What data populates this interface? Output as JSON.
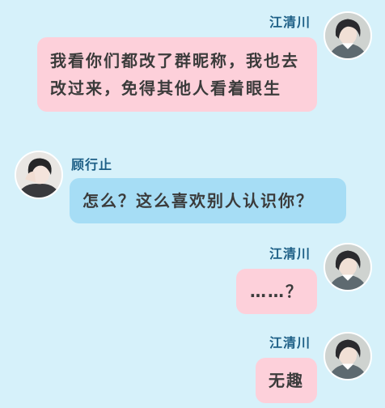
{
  "conversation": {
    "messages": [
      {
        "sender": "江清川",
        "text": "我看你们都改了群昵称，我也去改过来，免得其他人看着眼生",
        "side": "right",
        "bubble_color": "#fdd0da"
      },
      {
        "sender": "顾行止",
        "text": "怎么？这么喜欢别人认识你？",
        "side": "left",
        "bubble_color": "#a6ddf5"
      },
      {
        "sender": "江清川",
        "text": "……？",
        "side": "right",
        "bubble_color": "#fdd0da"
      },
      {
        "sender": "江清川",
        "text": "无趣",
        "side": "right",
        "bubble_color": "#fdd0da"
      }
    ]
  },
  "colors": {
    "background": "#d6f1fa",
    "name_text": "#1d5f86",
    "bubble_text": "#3b3b3b"
  },
  "icons": {
    "jiang_avatar": "avatar-dark-haired-man-icon",
    "gu_avatar": "avatar-hand-on-face-icon"
  }
}
